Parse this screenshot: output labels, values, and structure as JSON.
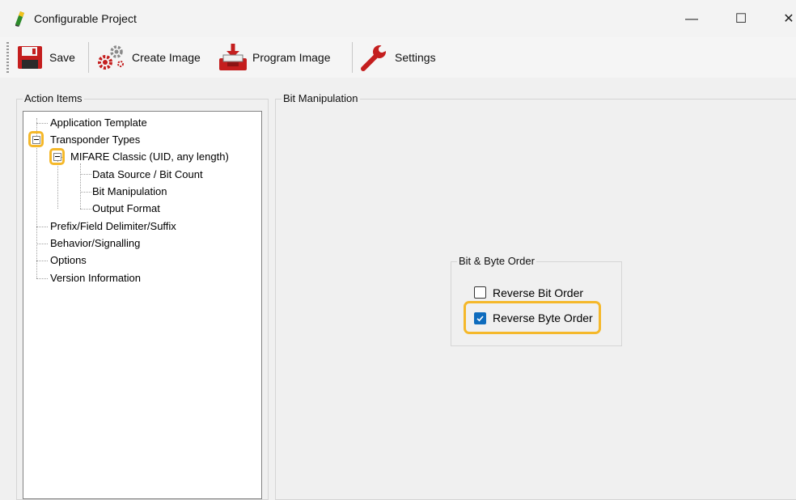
{
  "window": {
    "title": "Configurable Project",
    "min_glyph": "—",
    "max_glyph": "☐",
    "close_glyph": "✕"
  },
  "toolbar": {
    "save_label": "Save",
    "create_image_label": "Create Image",
    "program_image_label": "Program Image",
    "settings_label": "Settings"
  },
  "action_items": {
    "legend": "Action Items",
    "tree": [
      {
        "label": "Application Template"
      },
      {
        "label": "Transponder Types"
      },
      {
        "label": "MIFARE Classic (UID, any length)"
      },
      {
        "label": "Data Source / Bit Count"
      },
      {
        "label": "Bit Manipulation"
      },
      {
        "label": "Output Format"
      },
      {
        "label": "Prefix/Field Delimiter/Suffix"
      },
      {
        "label": "Behavior/Signalling"
      },
      {
        "label": "Options"
      },
      {
        "label": "Version Information"
      }
    ]
  },
  "bit_manipulation": {
    "legend": "Bit Manipulation",
    "order_group": {
      "legend": "Bit & Byte Order",
      "reverse_bit_order": {
        "label": "Reverse Bit Order",
        "checked": false
      },
      "reverse_byte_order": {
        "label": "Reverse Byte Order",
        "checked": true
      }
    }
  },
  "colors": {
    "highlight": "#f5b82a",
    "checkbox_accent": "#0f6cbd"
  }
}
